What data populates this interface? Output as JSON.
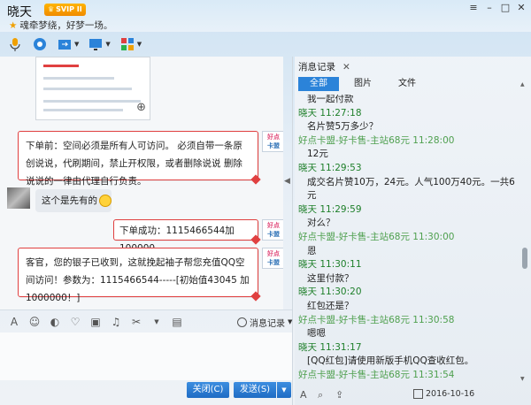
{
  "window": {
    "title": "晓天",
    "badge": "SVIP II",
    "signature": "魂牵梦绕，好梦一场。"
  },
  "toolbar": {
    "icons": [
      "mic-icon",
      "camera-icon",
      "file-transfer-icon",
      "remote-desktop-icon",
      "app-grid-icon"
    ]
  },
  "chat": {
    "messages": [
      {
        "type": "card",
        "text": "下单前：空间必须是所有人可访问。 必须自带一条原创说说，代刷期间，禁止开权限，或者删除说说 删除说说的一律由代理自行负责。"
      },
      {
        "type": "incoming",
        "text": "这个是先有的"
      },
      {
        "type": "card",
        "text": "下单成功：1115466544加100000"
      },
      {
        "type": "card",
        "text": "客官，您的银子已收到，这就挽起袖子帮您充值QQ空间访问！参数为：1115466544-----[初始值43045 加1000000！]"
      }
    ],
    "avatar_label_line1": "好点",
    "avatar_label_line2": "卡盟"
  },
  "input_toolbar": {
    "history_label": "消息记录"
  },
  "buttons": {
    "close": "关闭(C)",
    "send": "发送(S)"
  },
  "history": {
    "header": "消息记录",
    "tabs": [
      "全部",
      "图片",
      "文件"
    ],
    "entries": [
      {
        "kind": "content",
        "text": "我一起付款"
      },
      {
        "kind": "name",
        "text": "晓天 11:27:18"
      },
      {
        "kind": "content",
        "text": "名片赞5万多少？"
      },
      {
        "kind": "name2",
        "text": "好点卡盟-好卡售-主站68元 11:28:00"
      },
      {
        "kind": "content",
        "text": "12元"
      },
      {
        "kind": "name",
        "text": "晓天 11:29:53"
      },
      {
        "kind": "content",
        "text": "成交名片赞10万，24元。人气100万40元。一共64"
      },
      {
        "kind": "content",
        "text": "元"
      },
      {
        "kind": "name",
        "text": "晓天 11:29:59"
      },
      {
        "kind": "content",
        "text": "对么？"
      },
      {
        "kind": "name2",
        "text": "好点卡盟-好卡售-主站68元 11:30:00"
      },
      {
        "kind": "content",
        "text": "恩"
      },
      {
        "kind": "name",
        "text": "晓天 11:30:11"
      },
      {
        "kind": "content",
        "text": "这里付款？"
      },
      {
        "kind": "name",
        "text": "晓天 11:30:20"
      },
      {
        "kind": "content",
        "text": "红包还是？"
      },
      {
        "kind": "name2",
        "text": "好点卡盟-好卡售-主站68元 11:30:58"
      },
      {
        "kind": "content",
        "text": "嗯嗯"
      },
      {
        "kind": "name",
        "text": "晓天 11:31:17"
      },
      {
        "kind": "content",
        "text": "[QQ红包]请使用新版手机QQ查收红包。"
      },
      {
        "kind": "name2",
        "text": "好点卡盟-好卡售-主站68元 11:31:54"
      }
    ],
    "date": "2016-10-16"
  },
  "colors": {
    "accent": "#2b83d9",
    "card_border": "#e04040",
    "name_green": "#1e7f2a"
  }
}
